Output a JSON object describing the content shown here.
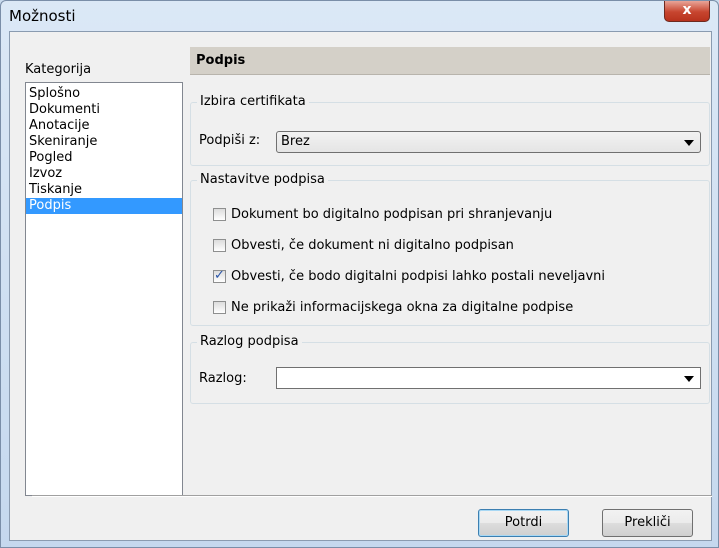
{
  "window": {
    "title": "Možnosti",
    "close_glyph": "x"
  },
  "sidebar": {
    "label": "Kategorija",
    "items": [
      {
        "label": "Splošno"
      },
      {
        "label": "Dokumenti"
      },
      {
        "label": "Anotacije"
      },
      {
        "label": "Skeniranje"
      },
      {
        "label": "Pogled"
      },
      {
        "label": "Izvoz"
      },
      {
        "label": "Tiskanje"
      },
      {
        "label": "Podpis",
        "selected": true
      }
    ]
  },
  "panel": {
    "title": "Podpis",
    "certificate_group": {
      "title": "Izbira certifikata",
      "sign_with_label": "Podpiši z:",
      "sign_with_value": "Brez"
    },
    "settings_group": {
      "title": "Nastavitve podpisa",
      "options": [
        {
          "label": "Dokument bo digitalno podpisan pri shranjevanju",
          "checked": false
        },
        {
          "label": "Obvesti, če dokument ni digitalno podpisan",
          "checked": false
        },
        {
          "label": "Obvesti, če bodo digitalni podpisi lahko postali neveljavni",
          "checked": true
        },
        {
          "label": "Ne prikaži informacijskega okna za digitalne podpise",
          "checked": false
        }
      ]
    },
    "reason_group": {
      "title": "Razlog podpisa",
      "reason_label": "Razlog:",
      "reason_value": ""
    }
  },
  "footer": {
    "ok_label": "Potrdi",
    "cancel_label": "Prekliči"
  }
}
